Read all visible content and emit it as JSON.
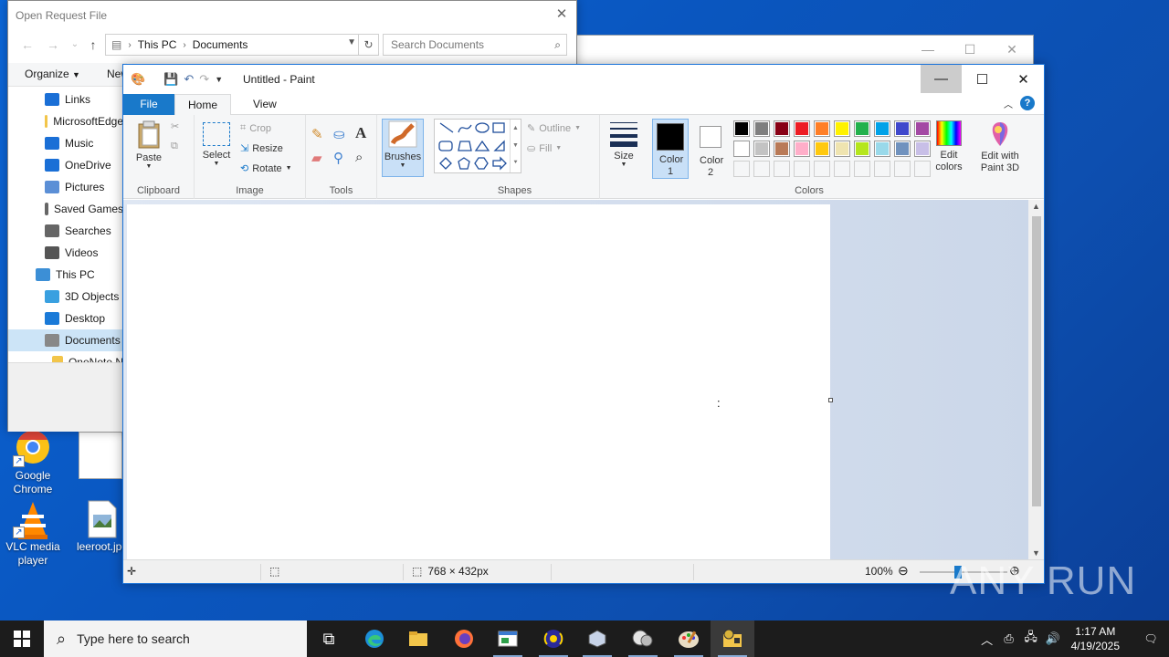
{
  "desktop": {
    "icons": [
      {
        "label": "Google Chrome"
      },
      {
        "label": "VLC media player"
      },
      {
        "label": "leeroot.jpg"
      }
    ],
    "watermark": "ANY RUN"
  },
  "dialog": {
    "title": "Open Request File",
    "address": {
      "root": "This PC",
      "folder": "Documents"
    },
    "search_placeholder": "Search Documents",
    "organize_label": "Organize",
    "new_label": "New",
    "tree": [
      {
        "label": "Links",
        "icon": "links-icon"
      },
      {
        "label": "MicrosoftEdge",
        "icon": "folder-icon"
      },
      {
        "label": "Music",
        "icon": "music-icon"
      },
      {
        "label": "OneDrive",
        "icon": "onedrive-icon"
      },
      {
        "label": "Pictures",
        "icon": "pictures-icon"
      },
      {
        "label": "Saved Games",
        "icon": "saved-games-icon"
      },
      {
        "label": "Searches",
        "icon": "searches-icon"
      },
      {
        "label": "Videos",
        "icon": "videos-icon"
      },
      {
        "label": "This PC",
        "icon": "pc-icon"
      },
      {
        "label": "3D Objects",
        "icon": "3d-objects-icon"
      },
      {
        "label": "Desktop",
        "icon": "desktop-icon"
      },
      {
        "label": "Documents",
        "icon": "documents-icon",
        "selected": true
      },
      {
        "label": "OneNote N",
        "icon": "folder-icon"
      }
    ]
  },
  "paint": {
    "title": "Untitled - Paint",
    "tabs": {
      "file": "File",
      "home": "Home",
      "view": "View"
    },
    "groups": {
      "clipboard": {
        "label": "Clipboard",
        "paste": "Paste"
      },
      "image": {
        "label": "Image",
        "select": "Select",
        "crop": "Crop",
        "resize": "Resize",
        "rotate": "Rotate"
      },
      "tools": {
        "label": "Tools"
      },
      "brushes": {
        "label": "Brushes"
      },
      "shapes": {
        "label": "Shapes",
        "outline": "Outline",
        "fill": "Fill"
      },
      "size": {
        "label": "Size"
      },
      "colors": {
        "label": "Colors",
        "color1": "Color 1",
        "color2": "Color 2",
        "edit_colors": "Edit colors",
        "edit_3d": "Edit with Paint 3D",
        "palette_row1": [
          "#000000",
          "#7f7f7f",
          "#880015",
          "#ed1c24",
          "#ff7f27",
          "#fff200",
          "#22b14c",
          "#00a2e8",
          "#3f48cc",
          "#a349a4"
        ],
        "palette_row2": [
          "#ffffff",
          "#c3c3c3",
          "#b97a57",
          "#ffaec9",
          "#ffc90e",
          "#efe4b0",
          "#b5e61d",
          "#99d9ea",
          "#7092be",
          "#c8bfe7"
        ]
      }
    },
    "canvas_marker": ":",
    "status": {
      "dimensions": "768 × 432px",
      "zoom": "100%"
    }
  },
  "taskbar": {
    "search_placeholder": "Type here to search",
    "time": "1:17 AM",
    "date": "4/19/2025"
  }
}
